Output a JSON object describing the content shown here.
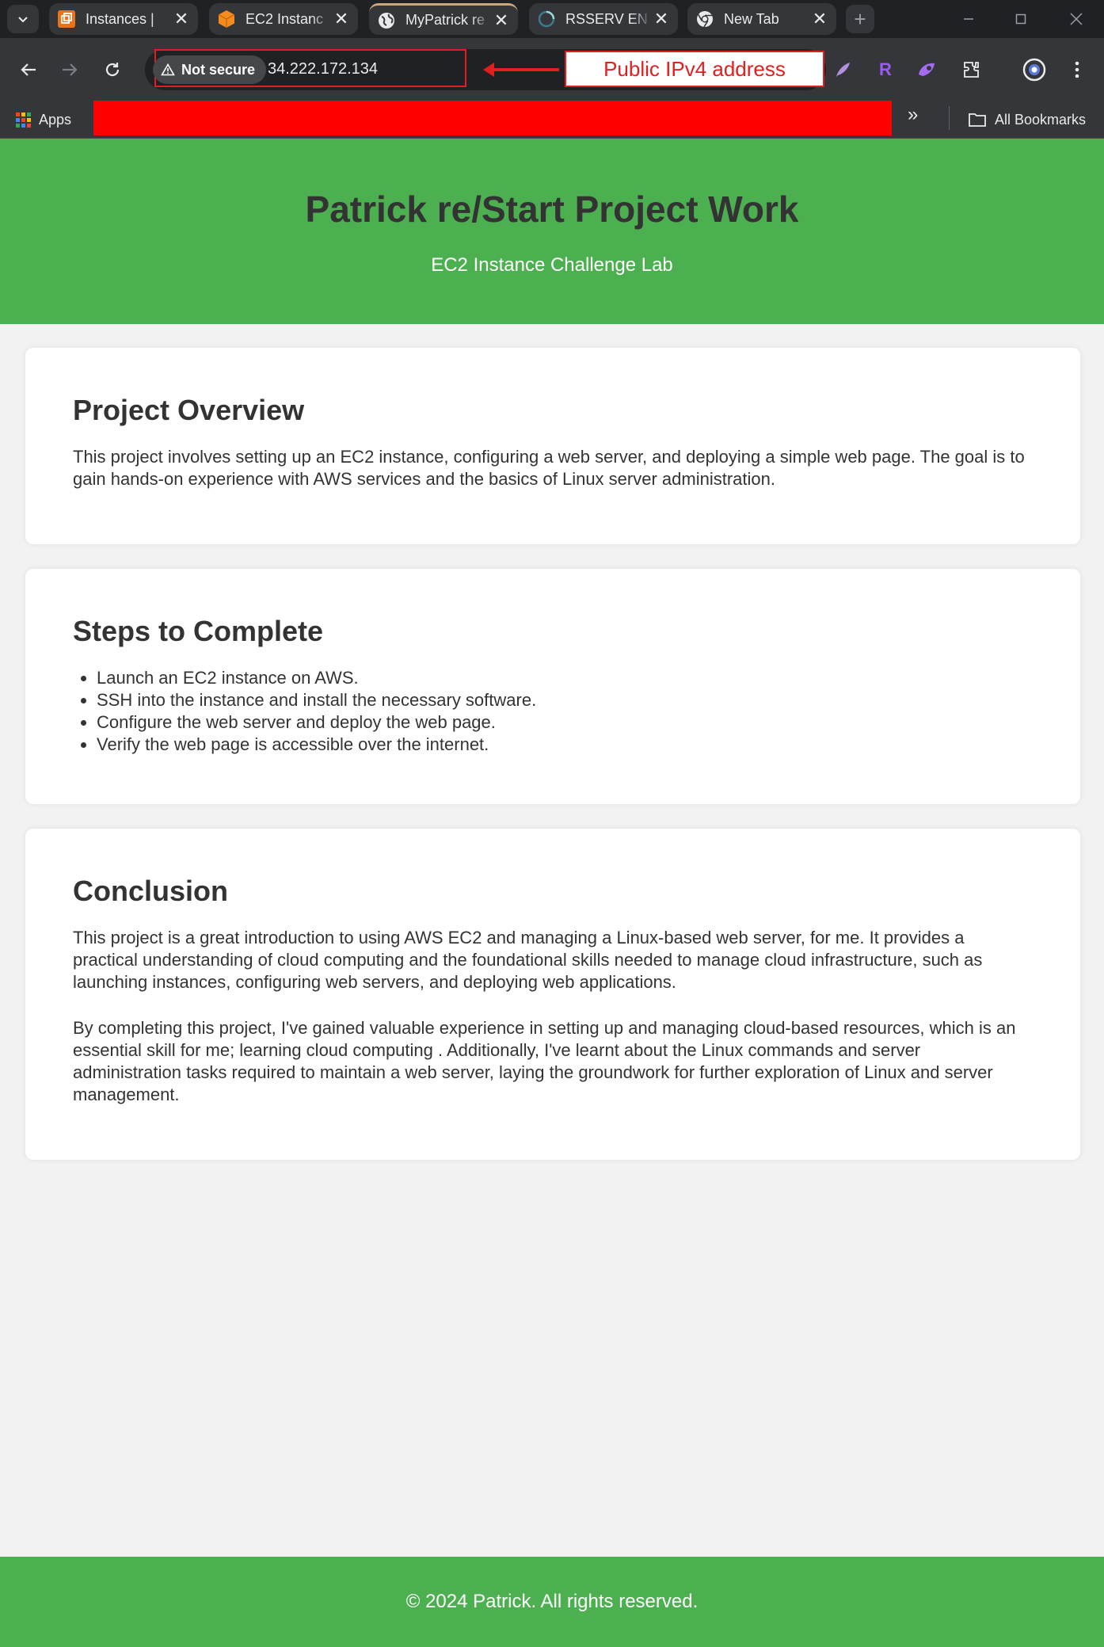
{
  "browser": {
    "tabs": [
      {
        "title": "Instances | ",
        "icon": "aws-instances-icon"
      },
      {
        "title": "EC2 Instanc",
        "icon": "aws-ec2-cube-icon"
      },
      {
        "title": "MyPatrick re",
        "icon": "globe-icon",
        "active": true
      },
      {
        "title": "RSSERV EN",
        "icon": "loading-spinner-icon"
      },
      {
        "title": "New Tab",
        "icon": "chrome-icon"
      }
    ],
    "new_tab_symbol": "+",
    "close_symbol": "✕",
    "security_label": "Not secure",
    "url": "34.222.172.134",
    "annotation": "Public IPv4 address",
    "annotation_color": "#e02020",
    "extensions": [
      "feather-icon",
      "r-icon",
      "puzzle-shape-icon",
      "extensions-icon",
      "profile-icon",
      "menu-icon"
    ],
    "extension_r_label": "R",
    "bookmarks": {
      "apps_label": "Apps",
      "more_symbol": "»",
      "all_label": "All Bookmarks",
      "redaction_color": "#ff0000"
    }
  },
  "page": {
    "header": {
      "title": "Patrick re/Start Project Work",
      "subtitle": "EC2 Instance Challenge Lab"
    },
    "overview": {
      "heading": "Project Overview",
      "text": "This project involves setting up an EC2 instance, configuring a web server, and deploying a simple web page. The goal is to gain hands-on experience with AWS services and the basics of Linux server administration."
    },
    "steps": {
      "heading": "Steps to Complete",
      "items": [
        "Launch an EC2 instance on AWS.",
        "SSH into the instance and install the necessary software.",
        "Configure the web server and deploy the web page.",
        "Verify the web page is accessible over the internet."
      ]
    },
    "conclusion": {
      "heading": "Conclusion",
      "paragraphs": [
        "This project is a great introduction to using AWS EC2 and managing a Linux-based web server, for me. It provides a practical understanding of cloud computing and the foundational skills needed to manage cloud infrastructure, such as launching instances, configuring web servers, and deploying web applications.",
        "By completing this project, I've gained valuable experience in setting up and managing cloud-based resources, which is an essential skill for me; learning cloud computing . Additionally, I've learnt about the Linux commands and server administration tasks required to maintain a web server, laying the groundwork for further exploration of Linux and server management."
      ]
    },
    "footer": "© 2024 Patrick. All rights reserved.",
    "colors": {
      "header_green": "#4caf50",
      "background": "#f2f2f2",
      "card": "#ffffff",
      "text": "#333333"
    }
  }
}
